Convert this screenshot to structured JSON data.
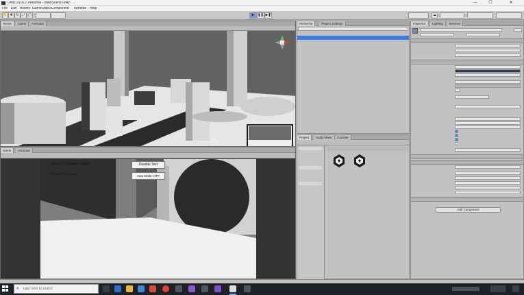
{
  "window": {
    "title": "Unity 2018.2 Personal - MainScene.unity - ...",
    "minimize": "—",
    "maximize": "☐",
    "close": "✕"
  },
  "menu": [
    "File",
    "Edit",
    "Assets",
    "GameObject",
    "Component",
    "Window",
    "Help"
  ],
  "toolbar": {
    "play_icon": "play-icon",
    "pause_icon": "pause-icon",
    "step_icon": "step-icon"
  },
  "scene_tabs": [
    "Scene",
    "Game",
    "Animator"
  ],
  "game_tabs": [
    "Game",
    "Animator"
  ],
  "game_overlay": {
    "author": "Author: Christopher Nolan",
    "subtitle": "Thought: Perception",
    "disable_text_button": "Disable Text",
    "auto_mode_button": "Auto Mode: OFF"
  },
  "hierarchy": {
    "tabs": [
      "Hierarchy",
      "Project Settings"
    ]
  },
  "project": {
    "tabs": [
      "Project",
      "Audio Mixer",
      "Console"
    ],
    "assets": [
      {
        "icon": "unity-icon"
      },
      {
        "icon": "unity-icon"
      }
    ]
  },
  "inspector": {
    "tabs": [
      "Inspector",
      "Lighting",
      "Services"
    ],
    "add_component": "Add Component"
  },
  "taskbar": {
    "search_placeholder": "Type here to search"
  },
  "colors": {
    "selection": "#3e7ce0",
    "panel": "#c2c2c2",
    "taskbar": "#1e2228",
    "titlebar": "#f3f3f3"
  }
}
